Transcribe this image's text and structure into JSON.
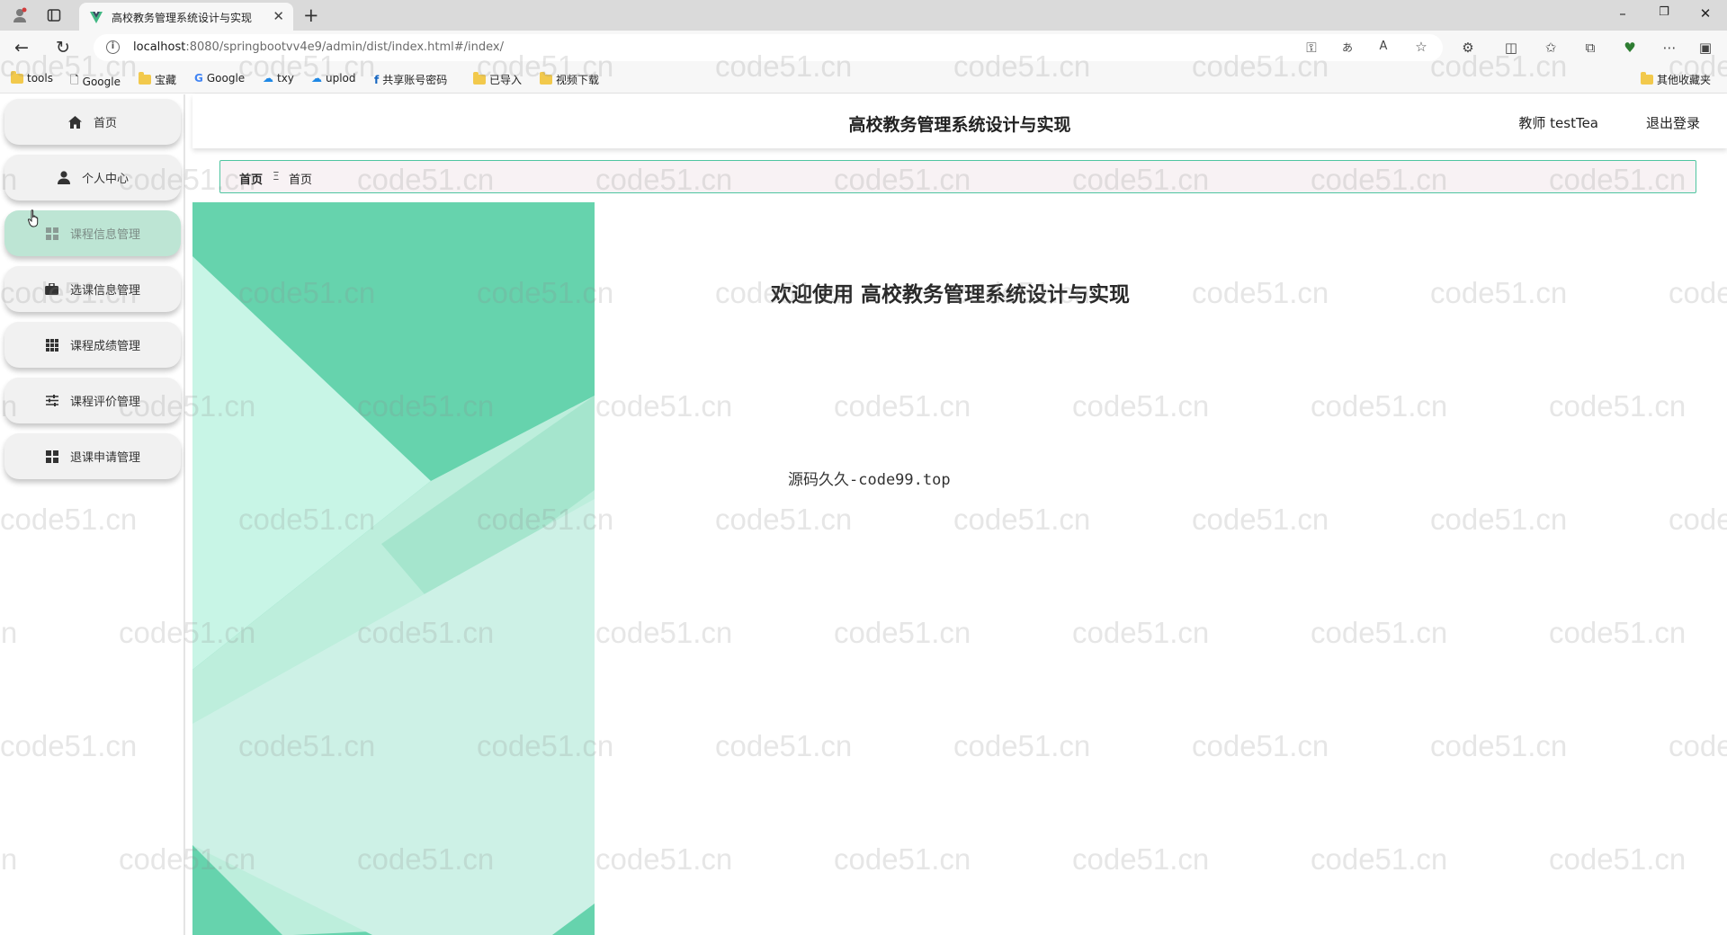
{
  "browser": {
    "tab_title": "高校教务管理系统设计与实现",
    "url_host": "localhost",
    "url_rest": ":8080/springbootvv4e9/admin/dist/index.html#/index/",
    "bookmarks": [
      "tools",
      "Google",
      "宝藏",
      "Google",
      "txy",
      "uplod",
      "共享账号密码",
      "已导入",
      "视频下载"
    ],
    "other_bookmarks": "其他收藏夹"
  },
  "sidebar": {
    "items": [
      {
        "label": "首页",
        "icon": "home-icon"
      },
      {
        "label": "个人中心",
        "icon": "user-icon"
      },
      {
        "label": "课程信息管理",
        "icon": "grid-icon"
      },
      {
        "label": "选课信息管理",
        "icon": "briefcase-icon"
      },
      {
        "label": "课程成绩管理",
        "icon": "grid-icon"
      },
      {
        "label": "课程评价管理",
        "icon": "sliders-icon"
      },
      {
        "label": "退课申请管理",
        "icon": "grid-icon"
      }
    ]
  },
  "header": {
    "title": "高校教务管理系统设计与实现",
    "user": "教师 testTea",
    "logout": "退出登录"
  },
  "breadcrumb": {
    "home": "首页",
    "current": "首页"
  },
  "main": {
    "welcome": "欢迎使用 高校教务管理系统设计与实现",
    "source": "源码久久-code99.top"
  },
  "watermark_text": "code51.cn",
  "colors": {
    "accent": "#4fc5a0",
    "sidebar_hover": "#bde5d4",
    "banner_green": "#66d3ad"
  }
}
